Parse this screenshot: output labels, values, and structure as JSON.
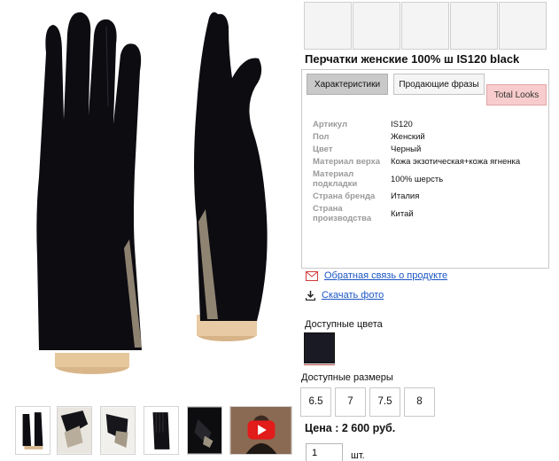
{
  "product": {
    "title": "Перчатки женские 100% ш IS120 black"
  },
  "tabs": [
    {
      "label": "Характеристики"
    },
    {
      "label": "Продающие фразы"
    },
    {
      "label": "Total Looks"
    }
  ],
  "specs": [
    {
      "label": "Артикул",
      "value": "IS120"
    },
    {
      "label": "Пол",
      "value": "Женский"
    },
    {
      "label": "Цвет",
      "value": "Черный"
    },
    {
      "label": "Материал верха",
      "value": "Кожа экзотическая+кожа ягненка"
    },
    {
      "label": "Материал подкладки",
      "value": "100% шерсть"
    },
    {
      "label": "Страна бренда",
      "value": "Италия"
    },
    {
      "label": "Страна производства",
      "value": "Китай"
    }
  ],
  "links": {
    "feedback": "Обратная связь о продукте",
    "download": "Скачать фото"
  },
  "colors": {
    "label": "Доступные цвета",
    "options": [
      {
        "name": "black",
        "hex": "#1a1a24"
      }
    ]
  },
  "sizes": {
    "label": "Доступные размеры",
    "options": [
      "6.5",
      "7",
      "7.5",
      "8"
    ]
  },
  "price": "Цена : 2 600 руб.",
  "quantity": {
    "value": "1",
    "unit": "шт."
  },
  "icons": {
    "feedback": "envelope-icon",
    "download": "download-icon",
    "video": "play-icon"
  },
  "accent_colors": {
    "link": "#1a55c4",
    "total_looks_tab": "#f8cccc",
    "video_play": "#e21b1b"
  }
}
